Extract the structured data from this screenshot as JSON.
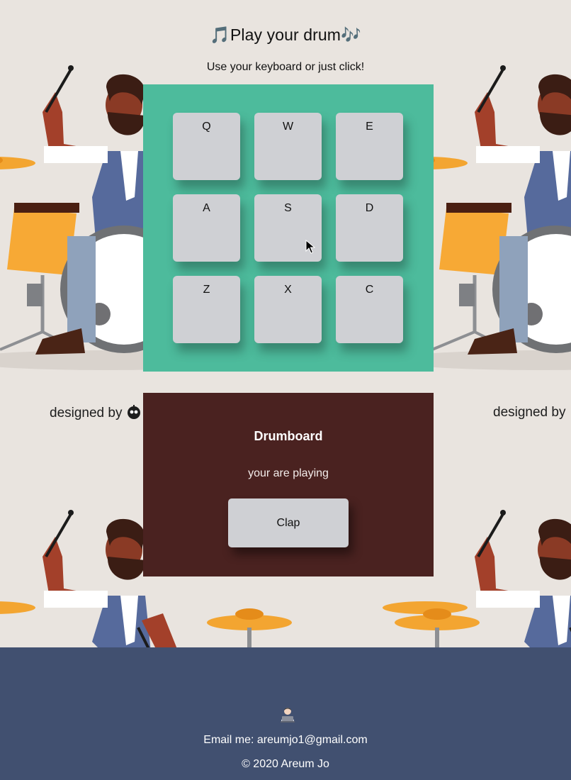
{
  "header": {
    "title": "🎵Play your drum🎶",
    "subtitle": "Use your keyboard or just click!"
  },
  "pads": [
    {
      "key": "Q"
    },
    {
      "key": "W"
    },
    {
      "key": "E"
    },
    {
      "key": "A"
    },
    {
      "key": "S"
    },
    {
      "key": "D"
    },
    {
      "key": "Z"
    },
    {
      "key": "X"
    },
    {
      "key": "C"
    }
  ],
  "display": {
    "title": "Drumboard",
    "caption": "your are playing",
    "current_sound": "Clap"
  },
  "background": {
    "credit": "designed by"
  },
  "footer": {
    "icon": "technologist-emoji-icon",
    "email": "Email me: areumjo1@gmail.com",
    "copyright": "© 2020 Areum Jo"
  },
  "colors": {
    "page_bg": "#e9e4df",
    "board_bg": "#4dbb9c",
    "pad_bg": "#cfd0d4",
    "display_bg": "#4a2220",
    "footer_bg": "#415070"
  }
}
